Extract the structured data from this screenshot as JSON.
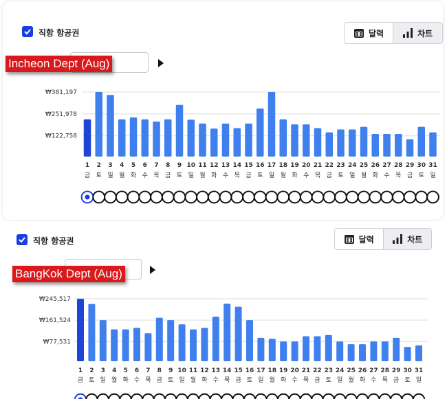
{
  "ui": {
    "checkbox_label": "직항 항공권",
    "calendar_btn": "달력",
    "chart_btn": "차트",
    "accent": "#1a3fe0",
    "bar_color": "#3f7fee",
    "bar_selected": "#1d45d6"
  },
  "chart_data": [
    {
      "type": "bar",
      "title": "Incheon Dept (Aug)",
      "categories": [
        "1",
        "2",
        "3",
        "4",
        "5",
        "6",
        "7",
        "8",
        "9",
        "10",
        "11",
        "12",
        "13",
        "14",
        "15",
        "16",
        "17",
        "18",
        "19",
        "20",
        "21",
        "22",
        "23",
        "24",
        "25",
        "26",
        "27",
        "28",
        "29",
        "30",
        "31"
      ],
      "weekdays": [
        "금",
        "토",
        "일",
        "월",
        "화",
        "수",
        "목",
        "금",
        "토",
        "일",
        "월",
        "화",
        "수",
        "목",
        "금",
        "토",
        "일",
        "월",
        "화",
        "수",
        "목",
        "금",
        "토",
        "일",
        "월",
        "화",
        "수",
        "목",
        "금",
        "토",
        "일"
      ],
      "values": [
        220000,
        381197,
        364000,
        220000,
        231000,
        220000,
        207000,
        220000,
        305000,
        218000,
        195000,
        165000,
        195000,
        168000,
        195000,
        284000,
        381197,
        220000,
        190000,
        190000,
        168000,
        143000,
        160000,
        160000,
        176000,
        134000,
        134000,
        134000,
        102000,
        176000,
        143000
      ],
      "yticks": [
        122758,
        251978,
        381197
      ],
      "ytick_labels": [
        "₩122,758",
        "₩251,978",
        "₩381,197"
      ],
      "ylim": [
        0,
        381197
      ],
      "selected_index": 0,
      "grid": true
    },
    {
      "type": "bar",
      "title": "BangKok Dept (Aug)",
      "categories": [
        "1",
        "2",
        "3",
        "4",
        "5",
        "6",
        "7",
        "8",
        "9",
        "10",
        "11",
        "12",
        "13",
        "14",
        "15",
        "16",
        "17",
        "18",
        "19",
        "20",
        "21",
        "22",
        "23",
        "24",
        "25",
        "26",
        "27",
        "28",
        "29",
        "30",
        "31"
      ],
      "weekdays": [
        "금",
        "토",
        "일",
        "월",
        "화",
        "수",
        "목",
        "금",
        "토",
        "일",
        "월",
        "화",
        "수",
        "목",
        "금",
        "토",
        "일",
        "월",
        "화",
        "수",
        "목",
        "금",
        "토",
        "일",
        "월",
        "화",
        "수",
        "목",
        "금",
        "토",
        "일"
      ],
      "values": [
        245517,
        225000,
        161524,
        125000,
        125000,
        131000,
        110000,
        171000,
        161524,
        145000,
        125000,
        131000,
        175000,
        226000,
        214000,
        161524,
        92000,
        88000,
        77531,
        77531,
        98000,
        98000,
        103000,
        77531,
        67000,
        67000,
        77531,
        77531,
        92000,
        56000,
        62000
      ],
      "yticks": [
        77531,
        161524,
        245517
      ],
      "ytick_labels": [
        "₩77,531",
        "₩161,524",
        "₩245,517"
      ],
      "ylim": [
        0,
        245517
      ],
      "selected_index": 0,
      "grid": true
    }
  ]
}
